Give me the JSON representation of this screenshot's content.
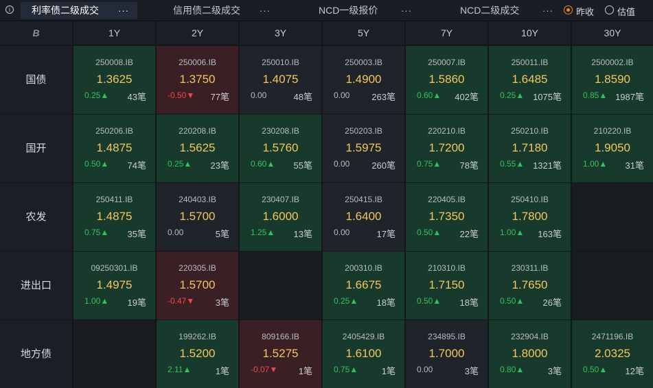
{
  "tabs": [
    {
      "label": "利率债二级成交",
      "more": "···",
      "active": true
    },
    {
      "label": "信用债二级成交",
      "more": "···",
      "active": false
    },
    {
      "label": "NCD一级报价",
      "more": "···",
      "active": false
    },
    {
      "label": "NCD二级成交",
      "more": "···",
      "active": false
    }
  ],
  "toggle": {
    "options": [
      {
        "label": "昨收",
        "selected": true
      },
      {
        "label": "估值",
        "selected": false
      }
    ],
    "accent_color": "#f38a22"
  },
  "table": {
    "corner_icon": "brand-logo-icon",
    "corner_glyph": "B",
    "columns": [
      "1Y",
      "2Y",
      "3Y",
      "5Y",
      "7Y",
      "10Y",
      "30Y"
    ],
    "rows": [
      {
        "label": "国债",
        "cells": [
          {
            "code": "250008.IB",
            "yield": "1.3625",
            "change": "0.25▲",
            "dir": "up",
            "count": "43笔"
          },
          {
            "code": "250006.IB",
            "yield": "1.3750",
            "change": "-0.50▼",
            "dir": "down",
            "count": "77笔"
          },
          {
            "code": "250010.IB",
            "yield": "1.4075",
            "change": "0.00",
            "dir": "flat",
            "count": "48笔"
          },
          {
            "code": "250003.IB",
            "yield": "1.4900",
            "change": "0.00",
            "dir": "flat",
            "count": "263笔"
          },
          {
            "code": "250007.IB",
            "yield": "1.5860",
            "change": "0.60▲",
            "dir": "up",
            "count": "402笔"
          },
          {
            "code": "250011.IB",
            "yield": "1.6485",
            "change": "0.25▲",
            "dir": "up",
            "count": "1075笔"
          },
          {
            "code": "2500002.IB",
            "yield": "1.8590",
            "change": "0.85▲",
            "dir": "up",
            "count": "1987笔"
          }
        ]
      },
      {
        "label": "国开",
        "cells": [
          {
            "code": "250206.IB",
            "yield": "1.4875",
            "change": "0.50▲",
            "dir": "up",
            "count": "74笔"
          },
          {
            "code": "220208.IB",
            "yield": "1.5625",
            "change": "0.25▲",
            "dir": "up",
            "count": "23笔"
          },
          {
            "code": "230208.IB",
            "yield": "1.5760",
            "change": "0.60▲",
            "dir": "up",
            "count": "55笔"
          },
          {
            "code": "250203.IB",
            "yield": "1.5975",
            "change": "0.00",
            "dir": "flat",
            "count": "260笔"
          },
          {
            "code": "220210.IB",
            "yield": "1.7200",
            "change": "0.75▲",
            "dir": "up",
            "count": "78笔"
          },
          {
            "code": "250210.IB",
            "yield": "1.7180",
            "change": "0.55▲",
            "dir": "up",
            "count": "1321笔"
          },
          {
            "code": "210220.IB",
            "yield": "1.9050",
            "change": "1.00▲",
            "dir": "up",
            "count": "31笔"
          }
        ]
      },
      {
        "label": "农发",
        "cells": [
          {
            "code": "250411.IB",
            "yield": "1.4875",
            "change": "0.75▲",
            "dir": "up",
            "count": "35笔"
          },
          {
            "code": "240403.IB",
            "yield": "1.5700",
            "change": "0.00",
            "dir": "flat",
            "count": "5笔"
          },
          {
            "code": "230407.IB",
            "yield": "1.6000",
            "change": "1.25▲",
            "dir": "up",
            "count": "13笔"
          },
          {
            "code": "250415.IB",
            "yield": "1.6400",
            "change": "0.00",
            "dir": "flat",
            "count": "17笔"
          },
          {
            "code": "220405.IB",
            "yield": "1.7350",
            "change": "0.50▲",
            "dir": "up",
            "count": "22笔"
          },
          {
            "code": "250410.IB",
            "yield": "1.7800",
            "change": "1.00▲",
            "dir": "up",
            "count": "163笔"
          },
          null
        ]
      },
      {
        "label": "进出口",
        "cells": [
          {
            "code": "09250301.IB",
            "yield": "1.4975",
            "change": "1.00▲",
            "dir": "up",
            "count": "19笔"
          },
          {
            "code": "220305.IB",
            "yield": "1.5700",
            "change": "-0.47▼",
            "dir": "down",
            "count": "3笔"
          },
          null,
          {
            "code": "200310.IB",
            "yield": "1.6675",
            "change": "0.25▲",
            "dir": "up",
            "count": "18笔"
          },
          {
            "code": "210310.IB",
            "yield": "1.7150",
            "change": "0.50▲",
            "dir": "up",
            "count": "18笔"
          },
          {
            "code": "230311.IB",
            "yield": "1.7650",
            "change": "0.50▲",
            "dir": "up",
            "count": "26笔"
          },
          null
        ]
      },
      {
        "label": "地方债",
        "cells": [
          null,
          {
            "code": "199262.IB",
            "yield": "1.5200",
            "change": "2.11▲",
            "dir": "up",
            "count": "1笔"
          },
          {
            "code": "809166.IB",
            "yield": "1.5275",
            "change": "-0.07▼",
            "dir": "down",
            "count": "1笔"
          },
          {
            "code": "2405429.IB",
            "yield": "1.6100",
            "change": "0.75▲",
            "dir": "up",
            "count": "1笔"
          },
          {
            "code": "234895.IB",
            "yield": "1.7000",
            "change": "0.00",
            "dir": "flat",
            "count": "3笔"
          },
          {
            "code": "232904.IB",
            "yield": "1.8000",
            "change": "0.80▲",
            "dir": "up",
            "count": "3笔"
          },
          {
            "code": "2471196.IB",
            "yield": "2.0325",
            "change": "0.50▲",
            "dir": "up",
            "count": "12笔"
          }
        ]
      }
    ]
  },
  "colors": {
    "up": "#2fc45a",
    "down": "#f04848",
    "yield": "#f5c65c",
    "cell_up_bg": "#173a2d",
    "cell_down_bg": "#3a2025"
  }
}
